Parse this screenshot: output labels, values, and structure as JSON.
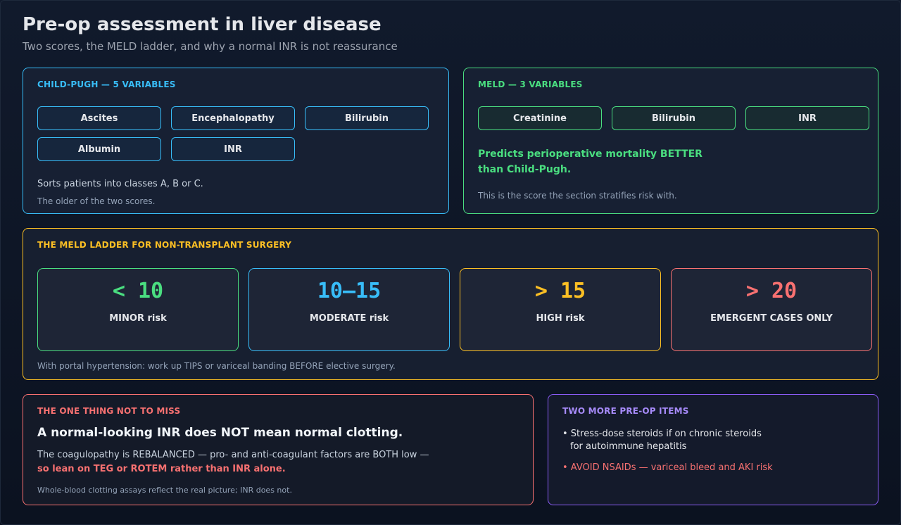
{
  "header": {
    "title": "Pre-op assessment in liver disease",
    "subtitle": "Two scores, the MELD ladder, and why a normal INR is not reassurance"
  },
  "child_pugh": {
    "heading": "CHILD-PUGH — 5 VARIABLES",
    "variables": [
      "Ascites",
      "Encephalopathy",
      "Bilirubin",
      "Albumin",
      "INR"
    ],
    "line1": "Sorts patients into classes A, B or C.",
    "line2": "The older of the two scores."
  },
  "meld": {
    "heading": "MELD — 3 VARIABLES",
    "variables": [
      "Creatinine",
      "Bilirubin",
      "INR"
    ],
    "emphasis_line1": "Predicts perioperative mortality BETTER",
    "emphasis_line2": "than Child-Pugh.",
    "note": "This is the score the section stratifies risk with."
  },
  "ladder": {
    "heading": "THE MELD LADDER FOR NON-TRANSPLANT SURGERY",
    "rungs": [
      {
        "range": "< 10",
        "label": "MINOR risk",
        "color": "#4ade80"
      },
      {
        "range": "10–15",
        "label": "MODERATE risk",
        "color": "#38bdf8"
      },
      {
        "range": "> 15",
        "label": "HIGH risk",
        "color": "#fbbf24"
      },
      {
        "range": "> 20",
        "label": "EMERGENT CASES ONLY",
        "color": "#f87171"
      }
    ],
    "footnote": "With portal hypertension: work up TIPS or variceal banding BEFORE elective surgery."
  },
  "not_to_miss": {
    "heading": "THE ONE THING NOT TO MISS",
    "headline": "A normal-looking INR does NOT mean normal clotting.",
    "body1": "The coagulopathy is REBALANCED — pro- and anti-coagulant factors are BOTH low —",
    "body2": "so lean on TEG or ROTEM rather than INR alone.",
    "footnote": "Whole-blood clotting assays reflect the real picture; INR does not."
  },
  "more_items": {
    "heading": "TWO MORE PRE-OP ITEMS",
    "item1_line1": "• Stress-dose steroids if on chronic steroids",
    "item1_line2": "for autoimmune hepatitis",
    "item2": "• AVOID NSAIDs — variceal bleed and AKI risk"
  }
}
